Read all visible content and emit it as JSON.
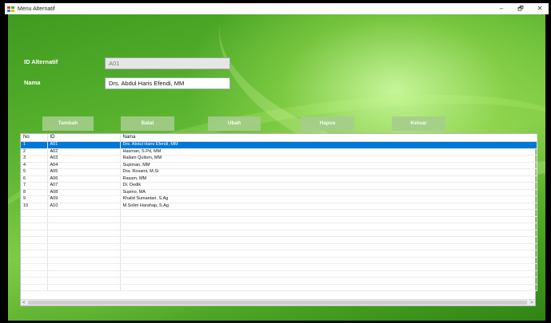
{
  "window": {
    "title": "Menu Alternatif",
    "minimize_glyph": "–",
    "maximize_glyph": "🗗",
    "close_glyph": "✕"
  },
  "form": {
    "id_label": "ID Alternatif",
    "id_value": "A01",
    "nama_label": "Nama",
    "nama_value": "Drs. Abdul Haris Efendi, MM"
  },
  "buttons": {
    "tambah": "Tambah",
    "batal": "Batal",
    "ubah": "Ubah",
    "hapus": "Hapus",
    "keluar": "Keluar"
  },
  "table": {
    "headers": [
      "No",
      "ID",
      "Nama"
    ],
    "rows": [
      [
        "1",
        "A01",
        "Drs. Abdul Haris Efendi, MM"
      ],
      [
        "2",
        "A02",
        "Hasman, S.Pd, MM"
      ],
      [
        "3",
        "A03",
        "Railam Qultom, MM"
      ],
      [
        "4",
        "A04",
        "Supiman, MM"
      ],
      [
        "5",
        "A05",
        "Dra. Rosami, M.Si"
      ],
      [
        "6",
        "A06",
        "Rasam, MM"
      ],
      [
        "7",
        "A07",
        "Dr. Dedik"
      ],
      [
        "8",
        "A08",
        "Supino, MA"
      ],
      [
        "9",
        "A09",
        "Khalid Sumantari, S.Ag"
      ],
      [
        "10",
        "A10",
        "M.Solim Harahap, S.Ag"
      ]
    ],
    "selected_row": 0,
    "empty_rows": 12
  },
  "scrollbar": {
    "left_arrow": "<",
    "right_arrow": ">"
  },
  "colors": {
    "selection": "#0078d7",
    "background_green": "#58b22e"
  }
}
